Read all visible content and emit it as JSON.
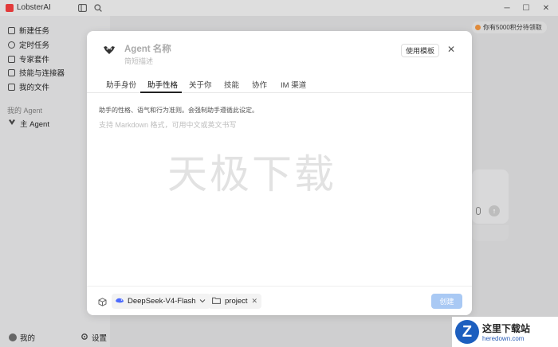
{
  "window": {
    "title": "LobsterAI",
    "controls": [
      "─",
      "☐",
      "✕"
    ]
  },
  "sidebar": {
    "items": [
      {
        "label": "新建任务",
        "icon": "edit-icon"
      },
      {
        "label": "定时任务",
        "icon": "clock-icon"
      },
      {
        "label": "专家套件",
        "icon": "grid-icon"
      },
      {
        "label": "技能与连接器",
        "icon": "plug-icon"
      },
      {
        "label": "我的文件",
        "icon": "file-icon"
      }
    ],
    "section_label": "我的 Agent",
    "agent_item": {
      "label": "主 Agent",
      "icon": "agent-icon"
    },
    "bottom_user": "我的",
    "bottom_settings": "设置"
  },
  "header": {
    "points_badge": "你有5000积分待领取"
  },
  "modal": {
    "agent_name": "Agent 名称",
    "agent_description": "简短描述",
    "template_button": "使用模板",
    "close": "✕",
    "tabs": [
      {
        "label": "助手身份"
      },
      {
        "label": "助手性格",
        "active": true
      },
      {
        "label": "关于你"
      },
      {
        "label": "技能"
      },
      {
        "label": "协作"
      },
      {
        "label": "IM 渠道"
      }
    ],
    "hint": "助手的性格、语气和行为准则。会强制助手遵循此设定。",
    "editor_placeholder": "支持 Markdown 格式，可用中文或英文书写",
    "watermark": "天极下载",
    "footer": {
      "model": "DeepSeek-V4-Flash",
      "folder": "project",
      "create_button": "创建"
    }
  },
  "brand": {
    "line1": "这里下载站",
    "line2": "heredown.com"
  },
  "colors": {
    "accent": "#a9c9f4",
    "logo": "#e23a3a"
  }
}
